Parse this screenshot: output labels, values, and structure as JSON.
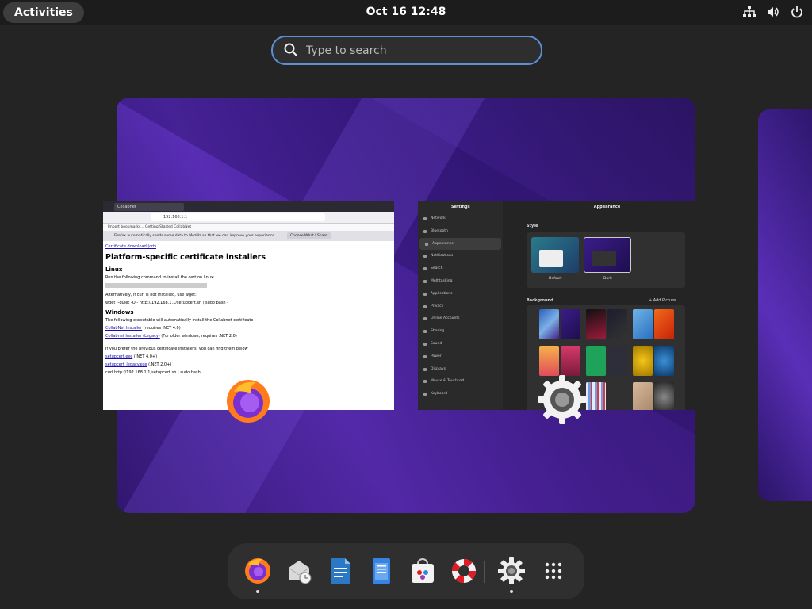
{
  "topbar": {
    "activities_label": "Activities",
    "clock": "Oct 16  12:48",
    "status_icons": [
      "network-icon",
      "volume-icon",
      "power-icon"
    ]
  },
  "search": {
    "placeholder": "Type to search",
    "accent": "#5b8fd6"
  },
  "windows": {
    "firefox": {
      "tab_title": "Collabnet",
      "url": "192.168.1.1",
      "bookmarks": "Import bookmarks...   Getting Started   CollabNet",
      "notice": "Firefox automatically sends some data to Mozilla so that we can improve your experience.",
      "notice_button": "Choose What I Share",
      "link_top": "Certificate download (crt)",
      "heading": "Platform-specific certificate installers",
      "linux_heading": "Linux",
      "linux_text": "Run the following command to install the cert on linux:",
      "linux_alt": "Alternatively, if curl is not installed, use wget:",
      "linux_wget": "wget --quiet -O - http://192.168.1.1/setupcert.sh | sudo bash -",
      "windows_heading": "Windows",
      "windows_text": "The following executable will automatically install the Collabnet certificate",
      "win_link1": "CollabNet Installer",
      "win_link1_note": "(requires .NET 4.0)",
      "win_link2": "Collabnet Installer (Legacy)",
      "win_link2_note": "(For older windows, requires .NET 2.0)",
      "more_text": "If you prefer the previous certificate installers, you can find them below",
      "link3": "setupcert.exe",
      "link3_note": "(.NET 4.0+)",
      "link4": "setupcert_legacy.exe",
      "link4_note": "(.NET 2.0+)",
      "last_line": "curl http://192.168.1.1/setupcert.sh | sudo bash"
    },
    "settings": {
      "title": "Settings",
      "page_title": "Appearance",
      "sidebar": [
        "Network",
        "Bluetooth",
        "Appearance",
        "Notifications",
        "Search",
        "Multitasking",
        "Applications",
        "Privacy",
        "Online Accounts",
        "Sharing",
        "Sound",
        "Power",
        "Displays",
        "Mouse & Touchpad",
        "Keyboard"
      ],
      "active_index": 2,
      "style_label": "Style",
      "style_options": [
        "Default",
        "Dark"
      ],
      "background_label": "Background",
      "add_picture": "+ Add Picture..."
    }
  },
  "dash": {
    "apps": [
      "firefox-icon",
      "mail-clock-icon",
      "writer-document-icon",
      "text-editor-icon",
      "software-store-icon",
      "help-lifebuoy-icon",
      "settings-gear-icon",
      "show-apps-grid-icon"
    ]
  }
}
